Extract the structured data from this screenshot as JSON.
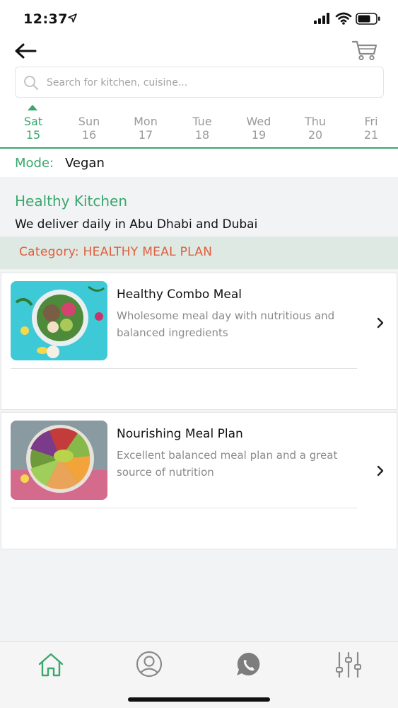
{
  "status": {
    "time": "12:37"
  },
  "search": {
    "placeholder": "Search for kitchen, cuisine..."
  },
  "days": [
    {
      "name": "Sat",
      "num": "15",
      "active": true
    },
    {
      "name": "Sun",
      "num": "16"
    },
    {
      "name": "Mon",
      "num": "17"
    },
    {
      "name": "Tue",
      "num": "18"
    },
    {
      "name": "Wed",
      "num": "19"
    },
    {
      "name": "Thu",
      "num": "20"
    },
    {
      "name": "Fri",
      "num": "21"
    }
  ],
  "mode": {
    "label": "Mode:",
    "value": "Vegan"
  },
  "kitchen": {
    "name": "Healthy Kitchen",
    "description": "We deliver daily in Abu Dhabi and Dubai"
  },
  "category": {
    "text": "Category: HEALTHY MEAL PLAN"
  },
  "meals": [
    {
      "title": "Healthy Combo Meal",
      "description": "Wholesome meal day with nutritious and balanced ingredients"
    },
    {
      "title": "Nourishing Meal Plan",
      "description": "Excellent balanced meal plan and a great source of nutrition"
    }
  ],
  "tabs": [
    {
      "icon": "home-icon",
      "active": true
    },
    {
      "icon": "profile-icon"
    },
    {
      "icon": "chat-icon"
    },
    {
      "icon": "filter-settings-icon"
    }
  ],
  "colors": {
    "accent": "#3aa76d",
    "category": "#e15d3d",
    "category_bg": "#dde9e2"
  }
}
